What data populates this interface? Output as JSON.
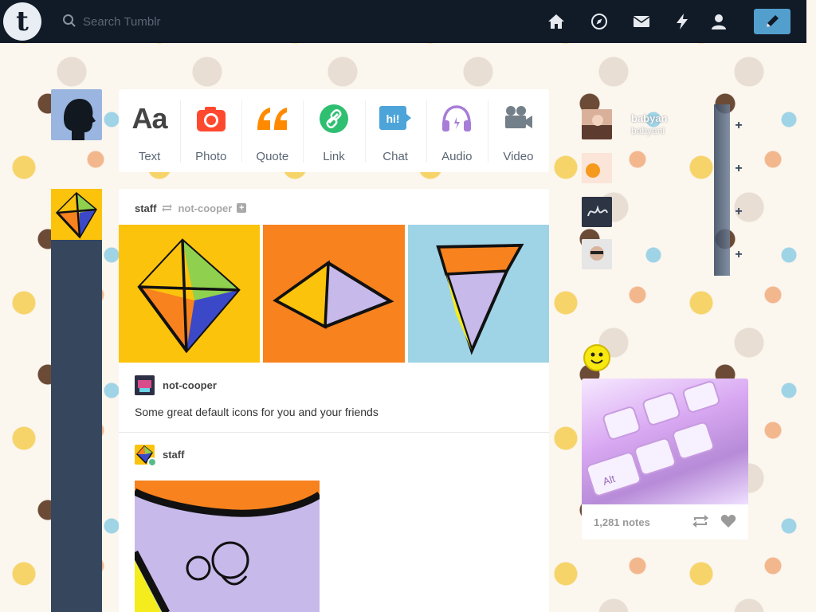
{
  "topbar": {
    "logo_letter": "t",
    "search_placeholder": "Search Tumblr",
    "nav_icons": [
      "home-icon",
      "explore-icon",
      "inbox-icon",
      "activity-icon",
      "account-icon"
    ],
    "compose_icon": "pencil-icon"
  },
  "post_types": [
    {
      "label": "Text",
      "glyph": "Aa",
      "color": "#444444"
    },
    {
      "label": "Photo",
      "glyph": "camera",
      "color": "#ff492f"
    },
    {
      "label": "Quote",
      "glyph": "“",
      "color": "#ff8a00"
    },
    {
      "label": "Link",
      "glyph": "link",
      "color": "#00cf35"
    },
    {
      "label": "Chat",
      "glyph": "hi!",
      "color": "#00b8ff"
    },
    {
      "label": "Audio",
      "glyph": "headphones",
      "color": "#7c5cff"
    },
    {
      "label": "Video",
      "glyph": "video",
      "color": "#748089"
    }
  ],
  "post": {
    "blog": "staff",
    "reblogged_from": "not-cooper",
    "reblog_author": "not-cooper",
    "reblog_text": "Some great default icons for you and your friends",
    "second_author": "staff"
  },
  "recommended": {
    "blog_1": "babyan",
    "blog_1_sub": "babyani"
  },
  "radar": {
    "notes": "1,281 notes",
    "key_label": "Alt"
  },
  "colors": {
    "topbar": "#111a27",
    "dashboard": "#36465d",
    "compose": "#529ecc"
  }
}
